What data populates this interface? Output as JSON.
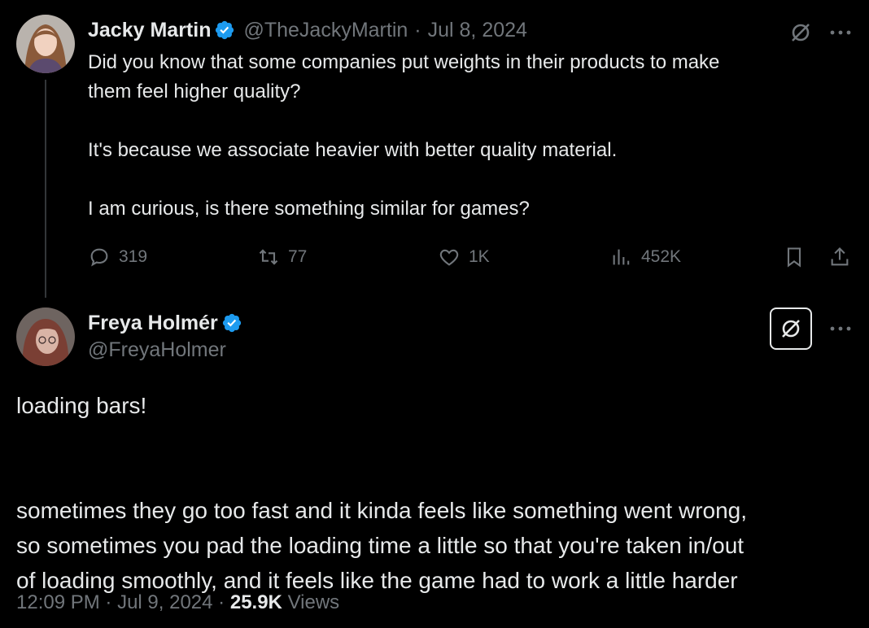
{
  "parent_tweet": {
    "author_name": "Jacky Martin",
    "handle": "@TheJackyMartin",
    "separator": "·",
    "date": "Jul 8, 2024",
    "text": "Did you know that some companies put weights in their products to make\nthem feel higher quality?\n\nIt's because we associate heavier with better quality material.\n\nI am curious, is there something similar for games?",
    "replies": "319",
    "reposts": "77",
    "likes": "1K",
    "views": "452K",
    "icons": [
      "grok-icon",
      "more-icon",
      "reply-icon",
      "repost-icon",
      "like-icon",
      "views-icon",
      "bookmark-icon",
      "share-icon"
    ]
  },
  "main_tweet": {
    "author_name": "Freya Holmér",
    "handle": "@FreyaHolmer",
    "text": "loading bars!\n\n\nsometimes they go too fast and it kinda feels like something went wrong,\nso sometimes you pad the loading time a little so that you're taken in/out\nof loading smoothly, and it feels like the game had to work a little harder",
    "time": "12:09 PM",
    "separator": "·",
    "date": "Jul 9, 2024",
    "separator2": "·",
    "view_count": "25.9K",
    "views_label": "Views",
    "icons": [
      "grok-icon",
      "more-icon"
    ]
  },
  "colors": {
    "background": "#000000",
    "text": "#e7e9ea",
    "muted": "#71767b",
    "verified": "#1d9bf0"
  }
}
